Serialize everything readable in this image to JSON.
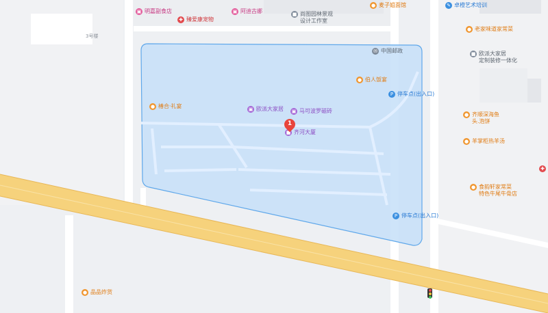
{
  "map": {
    "building_label": "3号楼",
    "marker_number": "1",
    "colors": {
      "highlight_fill": "#c6dff8",
      "highlight_stroke": "#5ea7ea",
      "expressway": "#f6d27c",
      "marker": "#e8453c"
    }
  },
  "pois": [
    {
      "label": "明嘉副食店",
      "icon": "shop-icon",
      "color": "pink"
    },
    {
      "label": "臻爱康宠物",
      "icon": "pet-icon",
      "color": "red"
    },
    {
      "label": "阿迪古娜",
      "icon": "shop-icon",
      "color": "pink"
    },
    {
      "label": "尚图园林景观\n设计工作室",
      "icon": "building-icon",
      "color": "gray"
    },
    {
      "label": "麦子姐面馆",
      "icon": "food-icon",
      "color": "orange"
    },
    {
      "label": "卓橙艺术培训",
      "icon": "education-icon",
      "color": "blue"
    },
    {
      "label": "老家味道家常菜",
      "icon": "food-icon",
      "color": "orange"
    },
    {
      "label": "欧派大家居\n定制装修一体化",
      "icon": "building-icon",
      "color": "gray"
    },
    {
      "label": "中国邮政",
      "icon": "post-office-icon",
      "color": "gray"
    },
    {
      "label": "伯人饭宴",
      "icon": "food-icon",
      "color": "orange"
    },
    {
      "label": "停车点(出入口)",
      "icon": "parking-icon",
      "color": "blue"
    },
    {
      "label": "椿合·礼宴",
      "icon": "food-icon",
      "color": "orange"
    },
    {
      "label": "欧派大家居",
      "icon": "shop-icon",
      "color": "purple"
    },
    {
      "label": "马可波罗磁砖",
      "icon": "shop-icon",
      "color": "purple"
    },
    {
      "label": "齐河大厦",
      "icon": "building-icon",
      "color": "purple"
    },
    {
      "label": "齐顺深海鱼\n头.泡饼",
      "icon": "food-icon",
      "color": "orange"
    },
    {
      "label": "羊掌柜热羊汤",
      "icon": "food-icon",
      "color": "orange"
    },
    {
      "label": "食韵轩家常菜\n特色牛尾牛骨店",
      "icon": "food-icon",
      "color": "orange"
    },
    {
      "label": "停车点(出入口)",
      "icon": "parking-icon",
      "color": "blue"
    },
    {
      "label": "品品炸货",
      "icon": "food-icon",
      "color": "orange"
    }
  ]
}
